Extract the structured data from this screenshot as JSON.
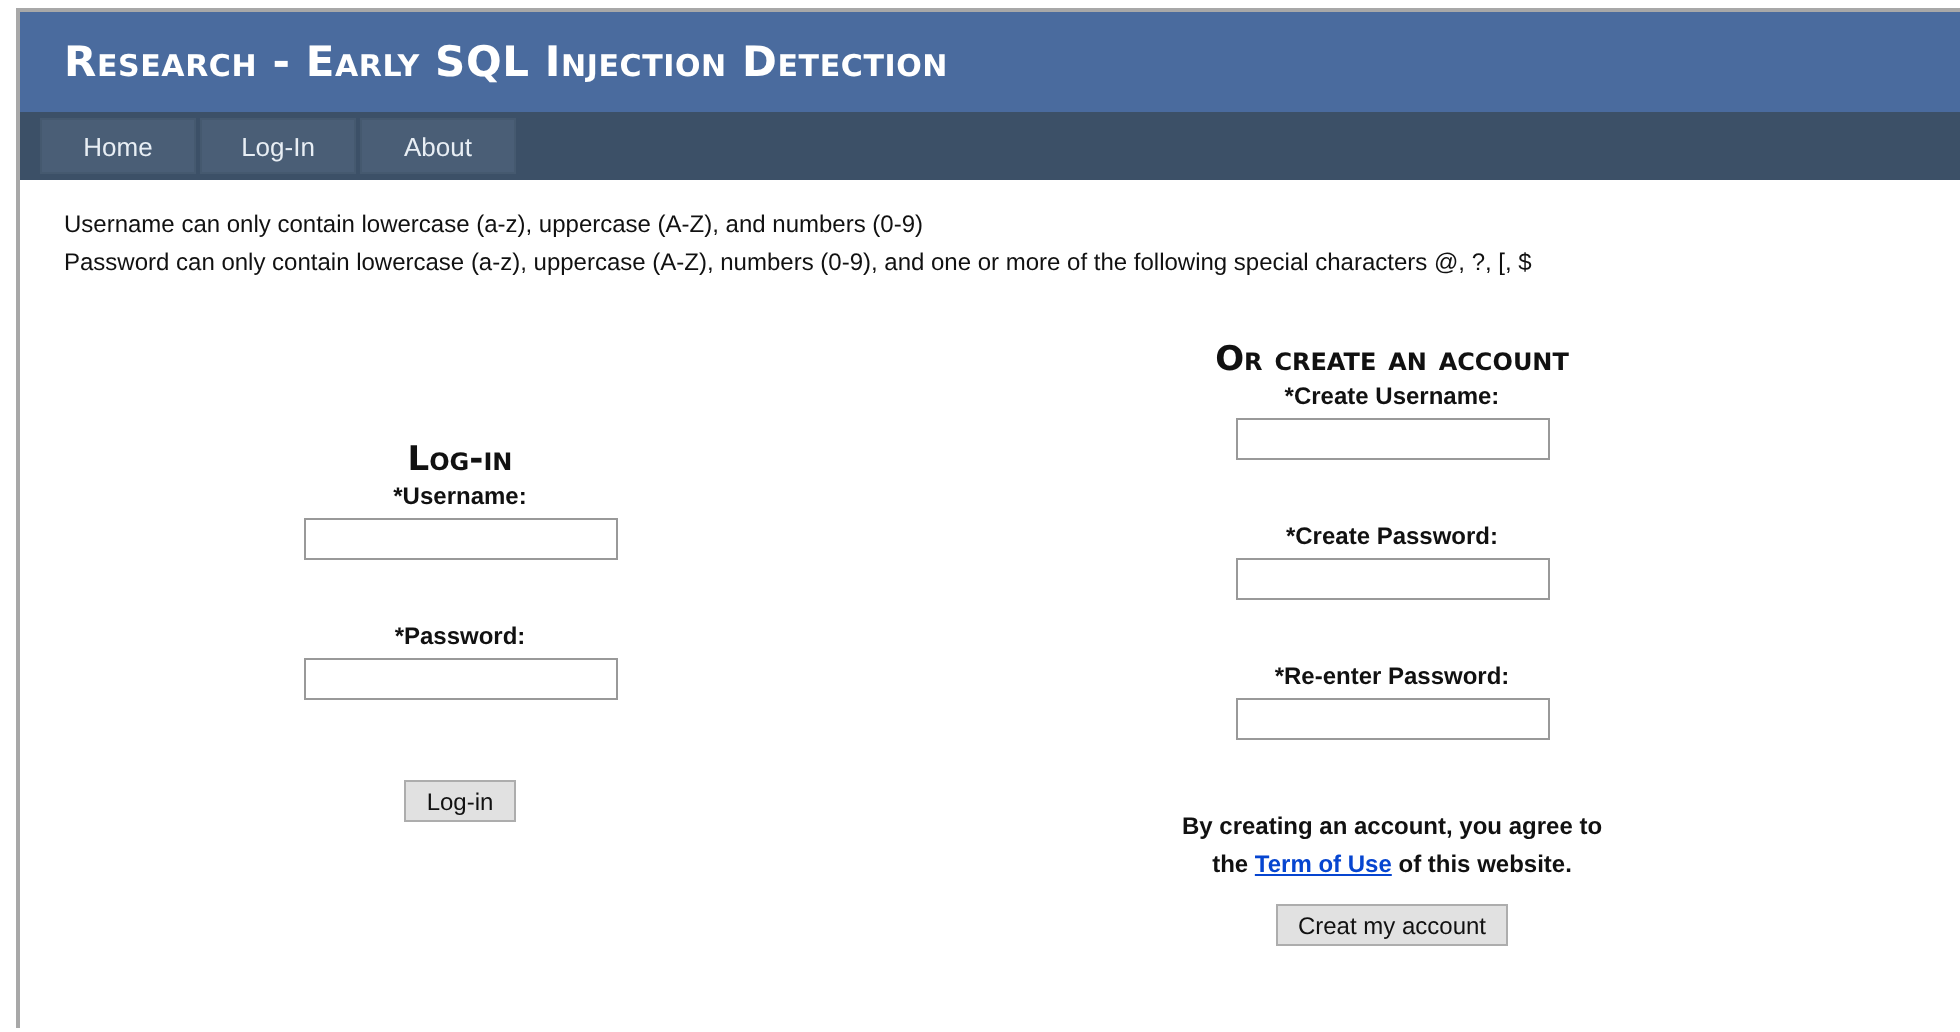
{
  "header": {
    "title": "Research - Early SQL Injection Detection"
  },
  "nav": [
    {
      "label": "Home"
    },
    {
      "label": "Log-In"
    },
    {
      "label": "About"
    }
  ],
  "rules": [
    "Username can only contain lowercase (a-z), uppercase (A-Z), and numbers (0-9)",
    "Password can only contain lowercase (a-z), uppercase (A-Z), numbers (0-9), and one or more of the following special characters @, ?, [, $"
  ],
  "login": {
    "heading": "Log-in",
    "fields": [
      {
        "label": "*Username:"
      },
      {
        "label": "*Password:"
      }
    ],
    "button": "Log-in"
  },
  "signup": {
    "heading": "Or create an account",
    "fields": [
      {
        "label": "*Create Username:"
      },
      {
        "label": "*Create Password:"
      },
      {
        "label": "*Re-enter Password:"
      }
    ],
    "agreement": {
      "before": "By creating an account, you agree to the",
      "link": "Term of Use",
      "after": "of this website."
    },
    "button": "Creat my account"
  }
}
